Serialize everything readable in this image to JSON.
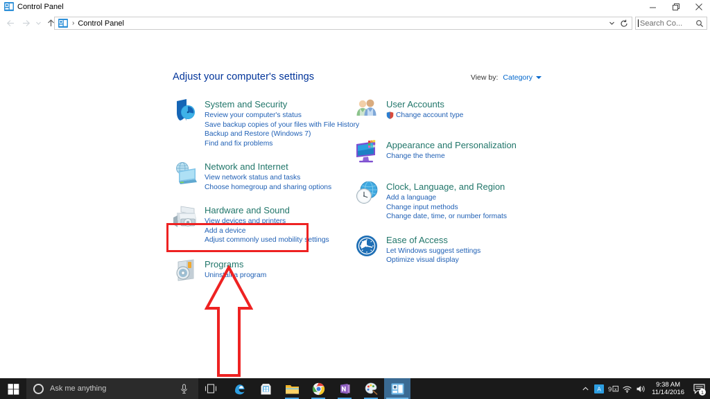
{
  "window": {
    "title": "Control Panel",
    "icon": "control-panel-icon",
    "buttons": {
      "minimize": "minimize-icon",
      "maximize": "restore-icon",
      "close": "close-icon"
    }
  },
  "addressbar": {
    "back": "back-arrow-icon",
    "forward": "forward-arrow-icon",
    "recent": "recent-locations-icon",
    "up": "up-arrow-icon",
    "crumb_icon": "control-panel-icon",
    "separator": "›",
    "crumb": "Control Panel",
    "dropdown": "chevron-down-icon",
    "refresh": "refresh-icon",
    "search_placeholder": "Search Co...",
    "search_value": "",
    "search_icon": "search-icon"
  },
  "content": {
    "heading": "Adjust your computer's settings",
    "view_by_label": "View by:",
    "view_by_value": "Category",
    "colors": {
      "heading": "#003399",
      "category_title": "#21766a",
      "link": "#2060b5",
      "annotation": "#ee2222"
    }
  },
  "categories_left": [
    {
      "icon": "shield-clock-icon",
      "title": "System and Security",
      "links": [
        "Review your computer's status",
        "Save backup copies of your files with File History",
        "Backup and Restore (Windows 7)",
        "Find and fix problems"
      ]
    },
    {
      "icon": "network-globe-monitor-icon",
      "title": "Network and Internet",
      "links": [
        "View network status and tasks",
        "Choose homegroup and sharing options"
      ]
    },
    {
      "icon": "printer-speaker-icon",
      "title": "Hardware and Sound",
      "links": [
        "View devices and printers",
        "Add a device",
        "Adjust commonly used mobility settings"
      ]
    },
    {
      "icon": "programs-disc-icon",
      "title": "Programs",
      "links": [
        "Uninstall a program"
      ]
    }
  ],
  "categories_right": [
    {
      "icon": "user-accounts-people-icon",
      "title": "User Accounts",
      "links": [
        "Change account type"
      ],
      "shield_on_first_link": true
    },
    {
      "icon": "monitor-palette-icon",
      "title": "Appearance and Personalization",
      "links": [
        "Change the theme"
      ]
    },
    {
      "icon": "clock-globe-icon",
      "title": "Clock, Language, and Region",
      "links": [
        "Add a language",
        "Change input methods",
        "Change date, time, or number formats"
      ]
    },
    {
      "icon": "ease-of-access-icon",
      "title": "Ease of Access",
      "links": [
        "Let Windows suggest settings",
        "Optimize visual display"
      ]
    }
  ],
  "annotation": {
    "highlight_target": "Programs",
    "shape_box": "red-rectangle-highlight",
    "shape_arrow": "red-up-arrow"
  },
  "taskbar": {
    "start": "windows-start-icon",
    "cortana_placeholder": "Ask me anything",
    "cortana_circle": "cortana-circle-icon",
    "mic": "microphone-icon",
    "task_view": "task-view-icon",
    "apps": [
      {
        "name": "edge-icon",
        "label": "Microsoft Edge",
        "running": false,
        "active": false
      },
      {
        "name": "store-icon",
        "label": "Microsoft Store",
        "running": false,
        "active": false
      },
      {
        "name": "file-explorer-icon",
        "label": "File Explorer",
        "running": true,
        "active": false
      },
      {
        "name": "chrome-icon",
        "label": "Google Chrome",
        "running": true,
        "active": false
      },
      {
        "name": "onenote-icon",
        "label": "OneNote",
        "running": true,
        "active": false
      },
      {
        "name": "paint-icon",
        "label": "Paint",
        "running": true,
        "active": false
      },
      {
        "name": "control-panel-icon",
        "label": "Control Panel",
        "running": true,
        "active": true
      }
    ],
    "tray": [
      "show-hidden-icons-chevron-icon",
      "ime-indicator-icon",
      "input-method-icon",
      "wifi-icon",
      "volume-icon"
    ],
    "clock_time": "9:38 AM",
    "clock_date": "11/14/2016",
    "notifications_icon": "action-center-icon",
    "notifications_count": "1"
  }
}
